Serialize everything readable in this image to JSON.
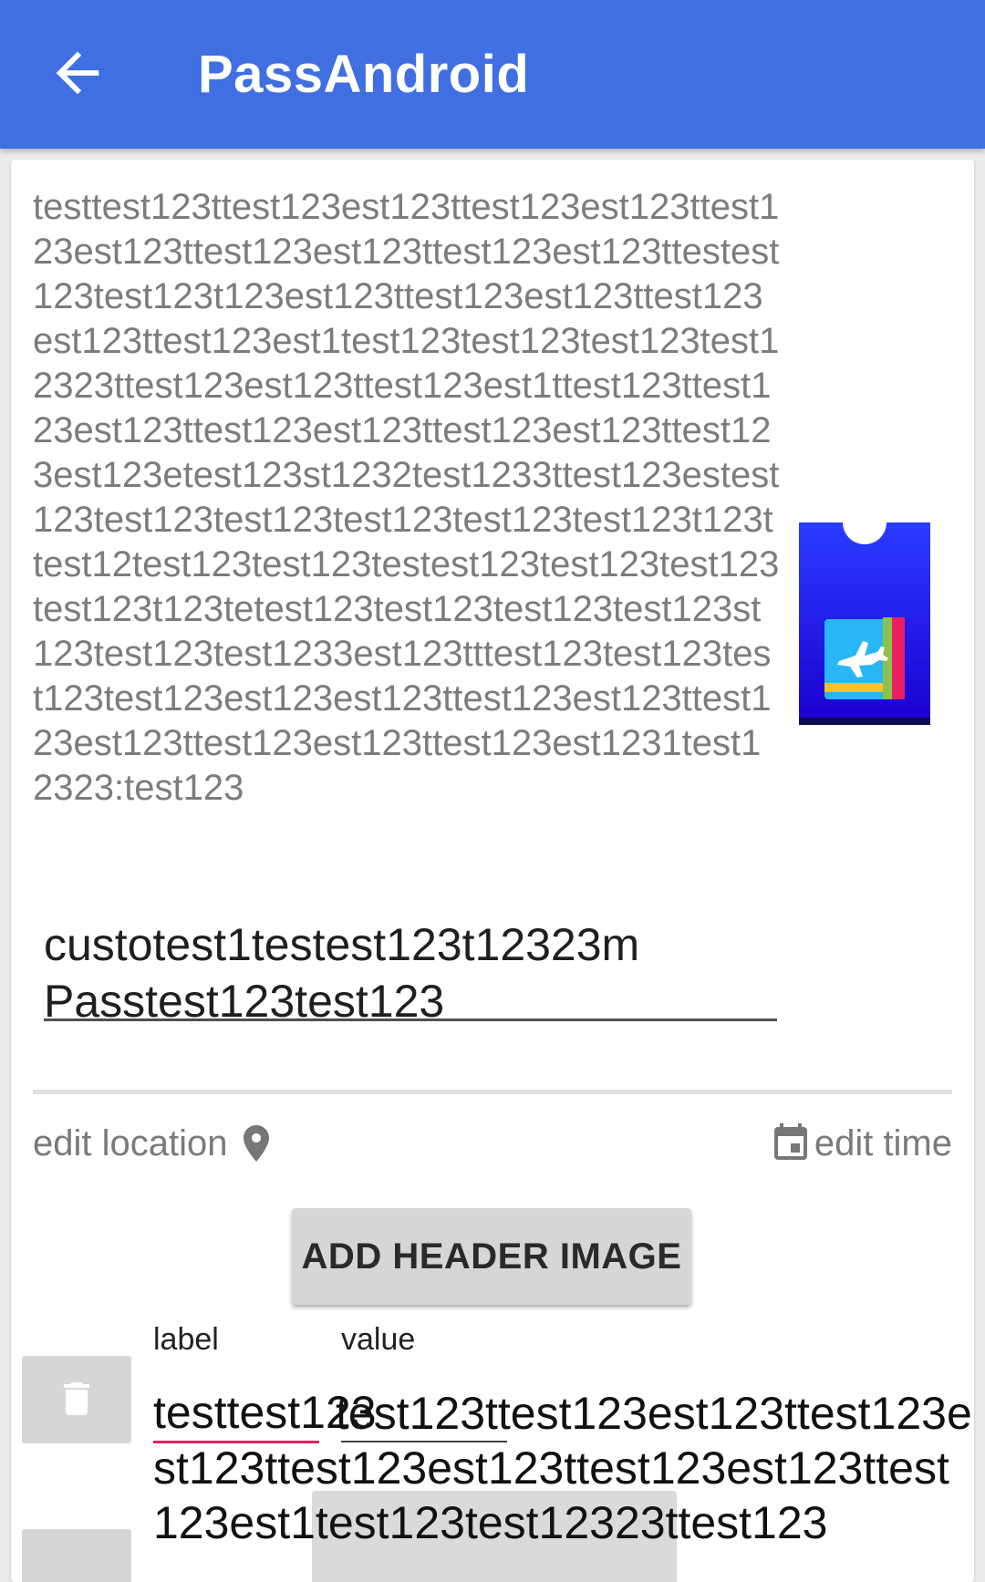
{
  "app": {
    "title": "PassAndroid"
  },
  "icons": {
    "back": "arrow-left-icon",
    "location": "map-pin-icon",
    "time": "calendar-icon",
    "delete": "trash-icon",
    "pass": "boarding-pass-icon"
  },
  "colors": {
    "appbar": "#3f6fe0",
    "pass_icon_bg": "#2b2bff",
    "error_underline": "#e0245e"
  },
  "pass": {
    "long_text": "testtest123ttest123est123ttest123est123ttest123est123ttest123est123ttest123est123ttestest123test123t123est123ttest123est123ttest123est123ttest123est1test123test123test123test12323ttest123est123ttest123est1ttest123ttest123est123ttest123est123ttest123est123ttest123est123etest123st1232test1233ttest123estest123test123test123test123test123test123t123ttest12test123test123testest123test123test123test123t123tetest123test123test123test123st123test123test1233est123tttest123test123test123test123est123est123ttest123est123ttest123est123ttest123est123ttest123est1231test12323:test123",
    "description_value": "custotest1testest123t12323m Passtest123test123"
  },
  "actions": {
    "edit_location": "edit location",
    "edit_time": "edit time",
    "add_header_image": "ADD HEADER IMAGE"
  },
  "fields": {
    "label_header": "label",
    "value_header": "value",
    "row1_label": "testtest123",
    "row1_value_overflow": "test123ttest123est123ttest123est123ttest123est123ttest123est123ttest123est1test123test12323ttest123"
  }
}
